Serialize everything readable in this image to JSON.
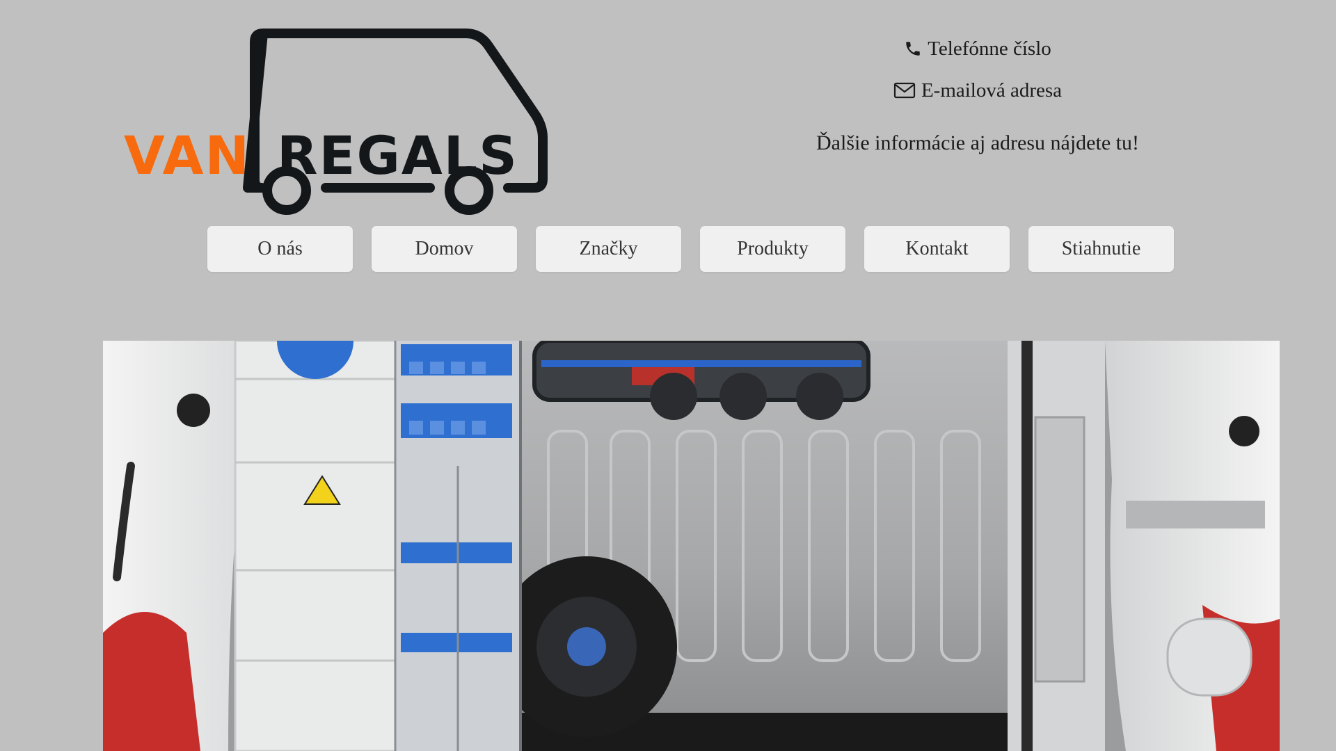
{
  "logo": {
    "text_orange": "VAN",
    "text_dark": "REGALS",
    "colors": {
      "orange": "#f76b0e",
      "dark": "#13171a"
    }
  },
  "contact": {
    "phone_icon": "phone-icon",
    "phone_label": "Telefónne číslo",
    "email_icon": "envelope-icon",
    "email_label": "E-mailová adresa",
    "info_text": "Ďalšie informácie aj adresu nájdete tu!"
  },
  "nav": {
    "items": [
      {
        "label": "O nás"
      },
      {
        "label": "Domov"
      },
      {
        "label": "Značky"
      },
      {
        "label": "Produkty"
      },
      {
        "label": "Kontakt"
      },
      {
        "label": "Stiahnutie"
      }
    ]
  },
  "hero": {
    "description_icon": "van-interior-photo"
  },
  "colors": {
    "page_background": "#c0c0c0",
    "button_background": "#f0f0f0",
    "shelf_blue": "#2e6fd0"
  }
}
